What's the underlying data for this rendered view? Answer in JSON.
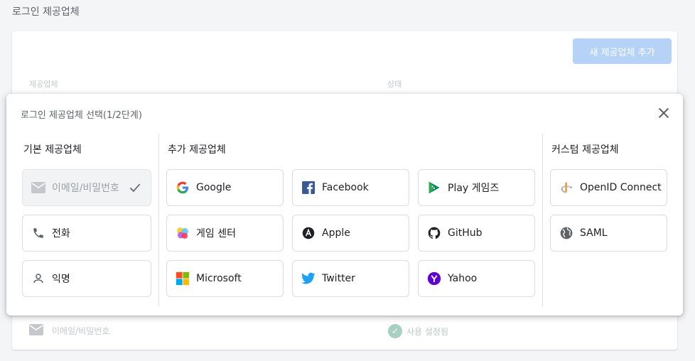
{
  "page": {
    "heading": "로그인 제공업체"
  },
  "background": {
    "add_button": "새 제공업체 추가",
    "col_provider": "제공업체",
    "col_status": "상태",
    "row_provider": "이메일/비밀번호",
    "row_status": "사용 설정됨"
  },
  "dialog": {
    "title": "로그인 제공업체 선택(1/2단계)",
    "sections": {
      "basic": "기본 제공업체",
      "additional": "추가 제공업체",
      "custom": "커스텀 제공업체"
    },
    "basic": [
      {
        "label": "이메일/비밀번호",
        "icon": "mail-icon",
        "enabled": false
      },
      {
        "label": "전화",
        "icon": "phone-icon"
      },
      {
        "label": "익명",
        "icon": "person-icon"
      }
    ],
    "additional": [
      {
        "label": "Google",
        "icon": "google-icon"
      },
      {
        "label": "Facebook",
        "icon": "facebook-icon"
      },
      {
        "label": "Play 게임즈",
        "icon": "play-games-icon"
      },
      {
        "label": "게임 센터",
        "icon": "game-center-icon"
      },
      {
        "label": "Apple",
        "icon": "apple-icon"
      },
      {
        "label": "GitHub",
        "icon": "github-icon"
      },
      {
        "label": "Microsoft",
        "icon": "microsoft-icon"
      },
      {
        "label": "Twitter",
        "icon": "twitter-icon"
      },
      {
        "label": "Yahoo",
        "icon": "yahoo-icon"
      }
    ],
    "custom": [
      {
        "label": "OpenID Connect",
        "icon": "openid-icon"
      },
      {
        "label": "SAML",
        "icon": "saml-globe-icon"
      }
    ]
  },
  "colors": {
    "accent_disabled": "#b7d2f7",
    "facebook": "#3b5998",
    "twitter": "#1da1f2",
    "yahoo": "#5f01d1",
    "enabled_status": "#a8cfc2"
  }
}
